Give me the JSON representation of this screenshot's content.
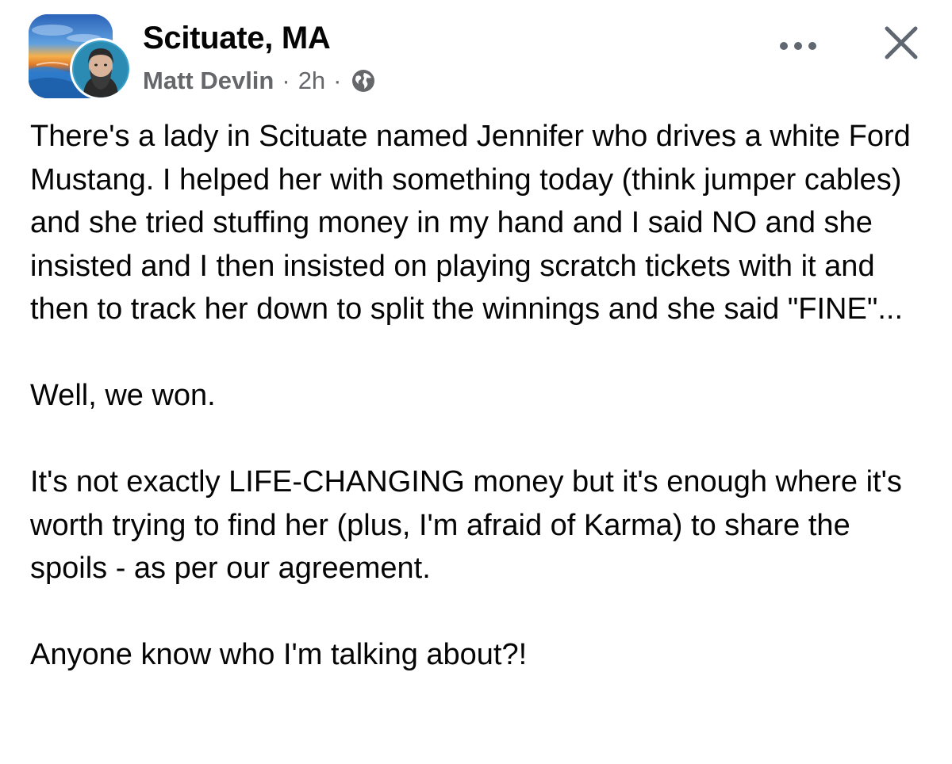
{
  "header": {
    "group_name": "Scituate, MA",
    "author": "Matt Devlin",
    "separator": "·",
    "timestamp": "2h",
    "audience_icon": "globe-icon",
    "more_icon": "more-horizontal-icon",
    "close_icon": "close-icon"
  },
  "post": {
    "paragraphs": [
      "There's a lady in Scituate named Jennifer who drives a white Ford Mustang.  I helped her with something today (think jumper cables) and she tried stuffing money in my hand and I said NO and she insisted and I then insisted on playing scratch tickets with it and then to track her down to split the winnings and she said \"FINE\"...",
      "Well, we won.",
      "It's not exactly LIFE-CHANGING money but it's enough where it's worth trying to find her (plus, I'm afraid of Karma) to share the spoils - as per our agreement.",
      "Anyone know who I'm talking about?!"
    ]
  },
  "colors": {
    "text_primary": "#050505",
    "text_secondary": "#65676b",
    "icon_gray": "#606770"
  }
}
